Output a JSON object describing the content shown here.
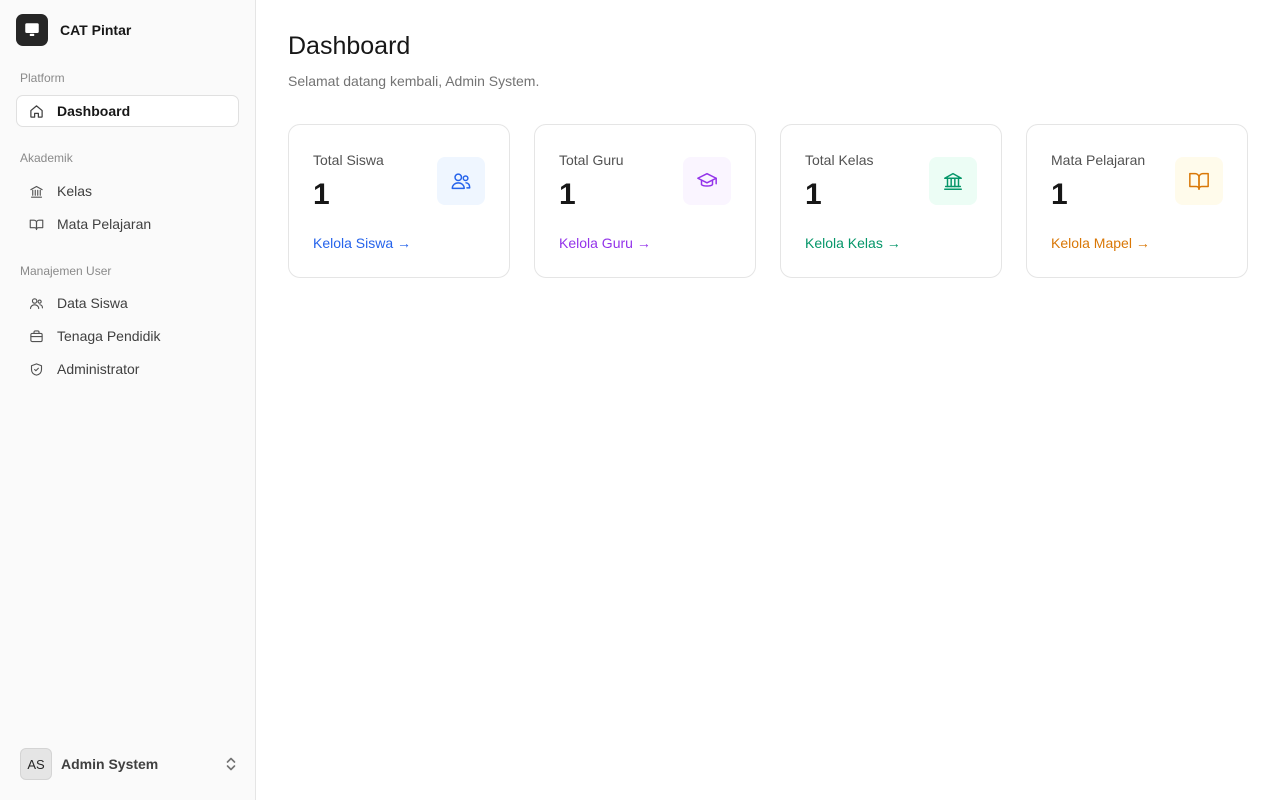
{
  "app": {
    "name": "CAT Pintar"
  },
  "sidebar": {
    "groups": [
      {
        "label": "Platform"
      },
      {
        "label": "Akademik"
      },
      {
        "label": "Manajemen User"
      }
    ],
    "items": [
      {
        "label": "Dashboard",
        "icon": "home-icon",
        "active": true
      },
      {
        "label": "Kelas",
        "icon": "building-icon"
      },
      {
        "label": "Mata Pelajaran",
        "icon": "book-icon"
      },
      {
        "label": "Data Siswa",
        "icon": "users-icon"
      },
      {
        "label": "Tenaga Pendidik",
        "icon": "briefcase-icon"
      },
      {
        "label": "Administrator",
        "icon": "shield-icon"
      }
    ]
  },
  "user": {
    "initials": "AS",
    "name": "Admin System"
  },
  "header": {
    "title": "Dashboard",
    "subtitle": "Selamat datang kembali, Admin System."
  },
  "cards": [
    {
      "label": "Total Siswa",
      "value": "1",
      "link": "Kelola Siswa →",
      "icon": "users-icon",
      "color": "#2563eb",
      "bg": "#eff6ff"
    },
    {
      "label": "Total Guru",
      "value": "1",
      "link": "Kelola Guru →",
      "icon": "graduation-cap-icon",
      "color": "#9333ea",
      "bg": "#faf5ff"
    },
    {
      "label": "Total Kelas",
      "value": "1",
      "link": "Kelola Kelas →",
      "icon": "building-icon",
      "color": "#059669",
      "bg": "#ecfdf5"
    },
    {
      "label": "Mata Pelajaran",
      "value": "1",
      "link": "Kelola Mapel →",
      "icon": "book-open-icon",
      "color": "#d97706",
      "bg": "#fffbeb"
    }
  ]
}
